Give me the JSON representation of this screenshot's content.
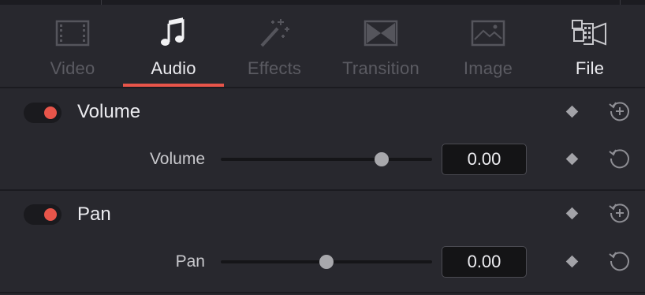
{
  "tabs": [
    {
      "label": "Video",
      "icon": "film-frame-icon",
      "state": "disabled"
    },
    {
      "label": "Audio",
      "icon": "music-note-icon",
      "state": "active"
    },
    {
      "label": "Effects",
      "icon": "magic-wand-icon",
      "state": "disabled"
    },
    {
      "label": "Transition",
      "icon": "transition-icon",
      "state": "disabled"
    },
    {
      "label": "Image",
      "icon": "image-icon",
      "state": "disabled"
    },
    {
      "label": "File",
      "icon": "film-camera-icon",
      "state": "normal"
    }
  ],
  "sections": [
    {
      "title": "Volume",
      "enabled": true,
      "param": {
        "label": "Volume",
        "value": "0.00",
        "slider_fraction": 0.76
      }
    },
    {
      "title": "Pan",
      "enabled": true,
      "param": {
        "label": "Pan",
        "value": "0.00",
        "slider_fraction": 0.5
      }
    }
  ],
  "colors": {
    "accent": "#e8554a",
    "background": "#28282e",
    "text": "#ececf0",
    "disabled_text": "#5b5b62"
  }
}
